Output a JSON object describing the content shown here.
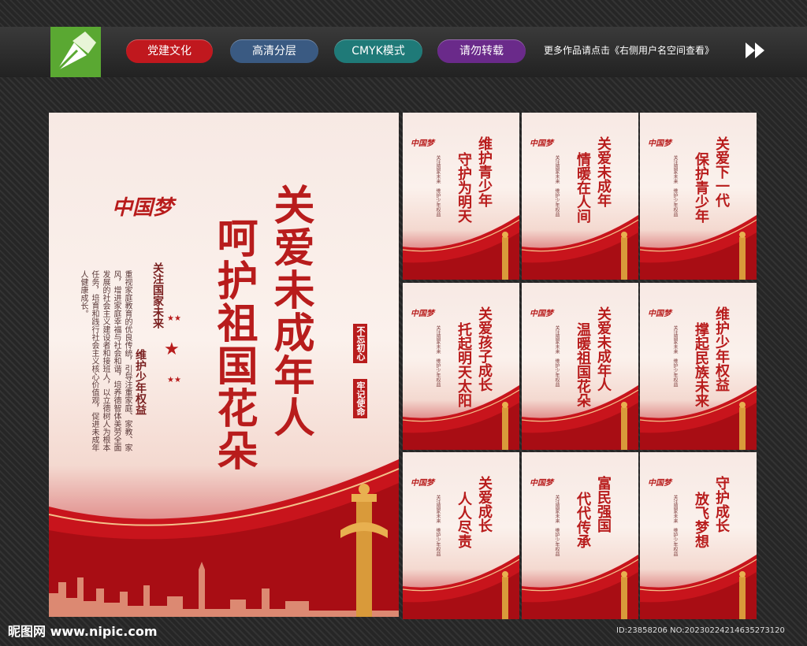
{
  "header": {
    "tags": [
      {
        "label": "党建文化",
        "color": "#c0181e"
      },
      {
        "label": "高清分层",
        "color": "#3a5a82"
      },
      {
        "label": "CMYK模式",
        "color": "#1f7a78"
      },
      {
        "label": "请勿转载",
        "color": "#6a2a8a"
      }
    ],
    "note": "更多作品请点击《右侧用户名空间查看》"
  },
  "main_poster": {
    "title_line1": "关爱未成年人",
    "title_line2": "呵护祖国花朵",
    "logo_text": "中国梦",
    "slogan_a": "关注国家未来",
    "slogan_b": "维护少年权益",
    "seal_a": "不忘初心",
    "seal_b": "牢记使命",
    "body": "重视家庭教育的优良传统，引导注重家庭、家教、家风，增进家庭幸福与社会和谐，培养德智体美劳全面发展的社会主义建设者和接班人，以立德树人为根本任务，培育和践行社会主义核心价值观，促进未成年人健康成长。"
  },
  "small_posters": [
    {
      "l1": "维护青少年",
      "l2": "守护为明天"
    },
    {
      "l1": "关爱未成年",
      "l2": "情暖在人间"
    },
    {
      "l1": "关爱下一代",
      "l2": "保护青少年"
    },
    {
      "l1": "关爱孩子成长",
      "l2": "托起明天太阳"
    },
    {
      "l1": "关爱未成年人",
      "l2": "温暖祖国花朵"
    },
    {
      "l1": "维护少年权益",
      "l2": "撑起民族未来"
    },
    {
      "l1": "关爱成长",
      "l2": "人人尽责"
    },
    {
      "l1": "富民强国",
      "l2": "代代传承"
    },
    {
      "l1": "守护成长",
      "l2": "放飞梦想"
    }
  ],
  "small_common": {
    "logo_text": "中国梦",
    "slogan": "关注国家未来　维护少年权益"
  },
  "footer": {
    "watermark": "昵图网 www.nipic.com",
    "id": "ID:23858206 NO:20230224214635273120"
  }
}
